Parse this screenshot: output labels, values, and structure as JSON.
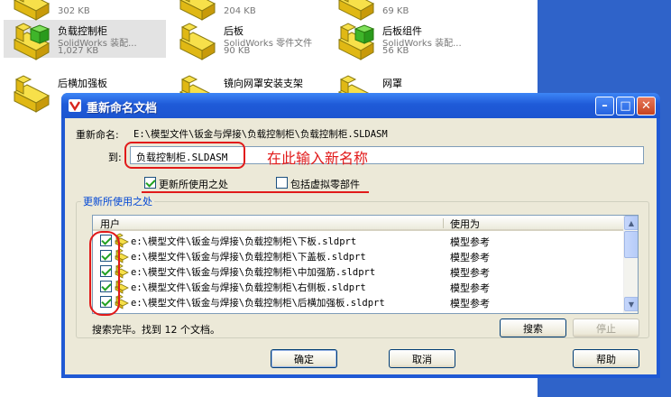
{
  "background_files": [
    {
      "name": "",
      "type": "",
      "size": "302 KB"
    },
    {
      "name": "",
      "type": "",
      "size": "204 KB"
    },
    {
      "name": "",
      "type": "",
      "size": "69 KB"
    },
    {
      "name": "负载控制柜",
      "type": "SolidWorks 装配...",
      "size": "1,027 KB"
    },
    {
      "name": "后板",
      "type": "SolidWorks 零件文件",
      "size": "90 KB"
    },
    {
      "name": "后板组件",
      "type": "SolidWorks 装配...",
      "size": "56 KB"
    },
    {
      "name": "后横加强板",
      "type": "",
      "size": ""
    },
    {
      "name": "镜向网罩安装支架",
      "type": "",
      "size": ""
    },
    {
      "name": "网罩",
      "type": "",
      "size": ""
    }
  ],
  "dialog": {
    "title": "重新命名文档",
    "rename_label": "重新命名:",
    "rename_path": "E:\\模型文件\\钣金与焊接\\负载控制柜\\负载控制柜.SLDASM",
    "to_label": "到:",
    "new_name_value": "负载控制柜.SLDASM",
    "annotation": "在此输入新名称",
    "update_where_used": {
      "label": "更新所使用之处",
      "checked": true
    },
    "include_virtual": {
      "label": "包括虚拟零部件",
      "checked": false
    },
    "group_label": "更新所使用之处",
    "columns": {
      "user": "用户",
      "used_as": "使用为"
    },
    "rows": [
      {
        "path": "e:\\模型文件\\钣金与焊接\\负载控制柜\\下板.sldprt",
        "used_as": "模型参考",
        "checked": true
      },
      {
        "path": "e:\\模型文件\\钣金与焊接\\负载控制柜\\下盖板.sldprt",
        "used_as": "模型参考",
        "checked": true
      },
      {
        "path": "e:\\模型文件\\钣金与焊接\\负载控制柜\\中加强筋.sldprt",
        "used_as": "模型参考",
        "checked": true
      },
      {
        "path": "e:\\模型文件\\钣金与焊接\\负载控制柜\\右侧板.sldprt",
        "used_as": "模型参考",
        "checked": true
      },
      {
        "path": "e:\\模型文件\\钣金与焊接\\负载控制柜\\后横加强板.sldprt",
        "used_as": "模型参考",
        "checked": true
      }
    ],
    "status": "搜索完毕。找到 12 个文档。",
    "search_button": "搜索",
    "stop_button": "停止",
    "ok_button": "确定",
    "cancel_button": "取消",
    "help_button": "帮助"
  },
  "colors": {
    "title_blue": "#1f59d4",
    "annotation_red": "#e11a1a",
    "dialog_face": "#ece9d8"
  }
}
